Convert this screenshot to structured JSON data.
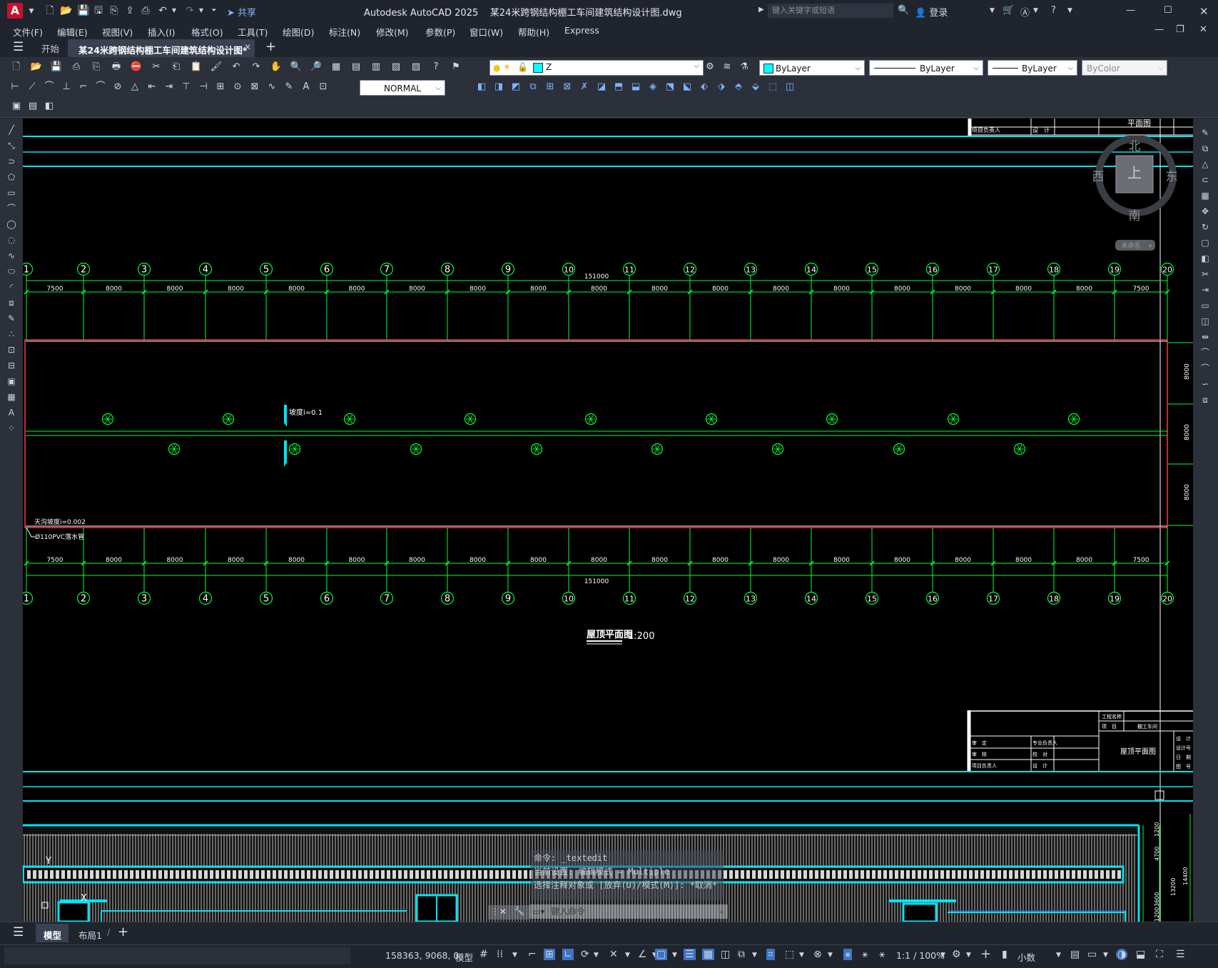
{
  "app": {
    "logo": "A",
    "title": "Autodesk AutoCAD 2025",
    "filename": "某24米跨钢结构棚工车间建筑结构设计图.dwg"
  },
  "quick_access": {
    "share_label": "共享"
  },
  "search": {
    "placeholder": "键入关键字或短语"
  },
  "account": {
    "login_label": "登录"
  },
  "menu": [
    "文件(F)",
    "编辑(E)",
    "视图(V)",
    "插入(I)",
    "格式(O)",
    "工具(T)",
    "绘图(D)",
    "标注(N)",
    "修改(M)",
    "参数(P)",
    "窗口(W)",
    "帮助(H)",
    "Express"
  ],
  "tabs": {
    "start": "开始",
    "document": "某24米跨钢结构棚工车间建筑结构设计图*",
    "add": "+"
  },
  "properties": {
    "layer": "Z",
    "color": "ByLayer",
    "linetype": "ByLayer",
    "lineweight": "ByLayer",
    "plotstyle": "ByColor",
    "textstyle": "NORMAL"
  },
  "viewcube": {
    "north": "北",
    "south": "南",
    "east": "东",
    "west": "西",
    "top": "上",
    "wcs": "未命名"
  },
  "drawing": {
    "grid_labels": [
      "1",
      "2",
      "3",
      "4",
      "5",
      "6",
      "7",
      "8",
      "9",
      "10",
      "11",
      "12",
      "13",
      "14",
      "15",
      "16",
      "17",
      "18",
      "19",
      "20"
    ],
    "spacings": [
      "7500",
      "8000",
      "8000",
      "8000",
      "8000",
      "8000",
      "8000",
      "8000",
      "8000",
      "8000",
      "8000",
      "8000",
      "8000",
      "8000",
      "8000",
      "8000",
      "8000",
      "8000",
      "7500"
    ],
    "total": "151000",
    "side_dims": [
      "8000",
      "8000",
      "8000"
    ],
    "slope_label": "坡度i=0.1",
    "gutter_label": "天沟坡度i=0.002",
    "pipe_label": "Ø110PVC落水管",
    "plan_title": "屋顶平面图",
    "plan_scale": "1:200",
    "title_block_top": [
      "项目负责人",
      "设　计",
      "平面图"
    ],
    "title_block": {
      "project_label": "工程名称",
      "item_label": "项　目",
      "item_value": "棚工车间",
      "rows": [
        [
          "审　定",
          "专业负责人"
        ],
        [
          "审　核",
          "校　对"
        ],
        [
          "项目负责人",
          "设　计"
        ]
      ],
      "sheet_title": "屋顶平面图",
      "right_col": [
        "设　计",
        "设计号",
        "日　期",
        "图　号"
      ]
    },
    "elevation_dims": [
      "1200",
      "4700",
      "13200",
      "14400",
      "3600",
      "1200"
    ]
  },
  "command": {
    "history": [
      "命令: _textedit",
      "当前设置: 编辑模式 = Multiple",
      "选择注释对象或 [放弃(U)/模式(M)]: *取消*"
    ],
    "input_placeholder": "键入命令"
  },
  "layout_tabs": {
    "model": "模型",
    "layout1": "布局1",
    "add": "+"
  },
  "status": {
    "coords": "158363, 9068, 0",
    "space": "模型",
    "scale": "1:1 / 100%",
    "units": "小数"
  }
}
